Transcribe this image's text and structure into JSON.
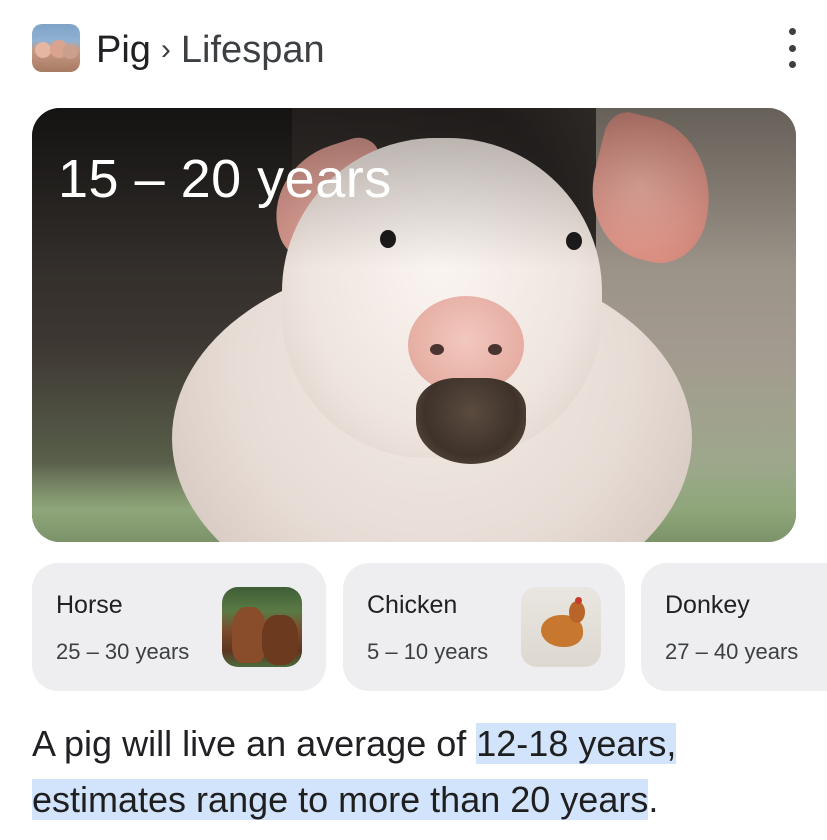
{
  "header": {
    "breadcrumb": {
      "entity": "Pig",
      "separator": "›",
      "attribute": "Lifespan"
    },
    "thumbnail_icon": "pig-thumbnail",
    "menu_icon": "more-vert-icon"
  },
  "hero": {
    "title": "15 – 20 years",
    "image": "pig-photo"
  },
  "related": [
    {
      "name": "Horse",
      "lifespan": "25 – 30 years",
      "image": "horse-photo"
    },
    {
      "name": "Chicken",
      "lifespan": "5 – 10 years",
      "image": "chicken-photo"
    },
    {
      "name": "Donkey",
      "lifespan": "27 – 40 years"
    }
  ],
  "answer": {
    "prefix": "A pig will live an average of ",
    "highlight1": "12-18 years,",
    "highlight2": "estimates range to more than 20 years",
    "suffix": ".",
    "highlight_color": "#d2e3fc"
  }
}
